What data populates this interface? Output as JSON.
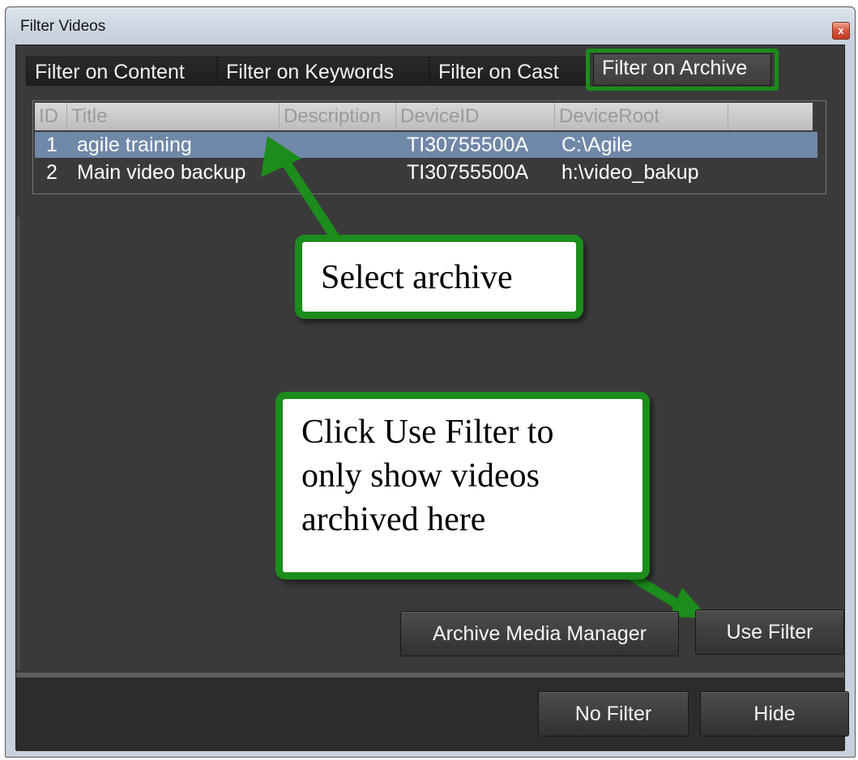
{
  "window": {
    "title": "Filter Videos",
    "close_glyph": "x"
  },
  "tabs": [
    {
      "label": "Filter on Content",
      "active": false
    },
    {
      "label": "Filter on Keywords",
      "active": false
    },
    {
      "label": "Filter on Cast",
      "active": false
    },
    {
      "label": "Filter on Archive",
      "active": true
    }
  ],
  "grid": {
    "columns": [
      "ID",
      "Title",
      "Description",
      "DeviceID",
      "DeviceRoot"
    ],
    "rows": [
      {
        "id": "1",
        "title": "agile training",
        "description": "",
        "device_id": "TI30755500A",
        "device_root": "C:\\Agile",
        "selected": true
      },
      {
        "id": "2",
        "title": "Main video backup",
        "description": "",
        "device_id": "TI30755500A",
        "device_root": "h:\\video_bakup",
        "selected": false
      }
    ]
  },
  "callouts": {
    "select_archive": "Select archive",
    "use_filter_line1": "Click Use Filter to",
    "use_filter_line2": "only show videos",
    "use_filter_line3": "archived here"
  },
  "buttons": {
    "archive_media_manager": "Archive Media Manager",
    "use_filter": "Use Filter",
    "no_filter": "No Filter",
    "hide": "Hide"
  },
  "colors": {
    "annotation_green": "#1c8c1c",
    "selected_row": "#7088a8",
    "panel_background": "#3a3a3a"
  },
  "icons": [
    "close-icon",
    "arrow-to-selected-row-icon",
    "arrow-to-use-filter-icon"
  ]
}
